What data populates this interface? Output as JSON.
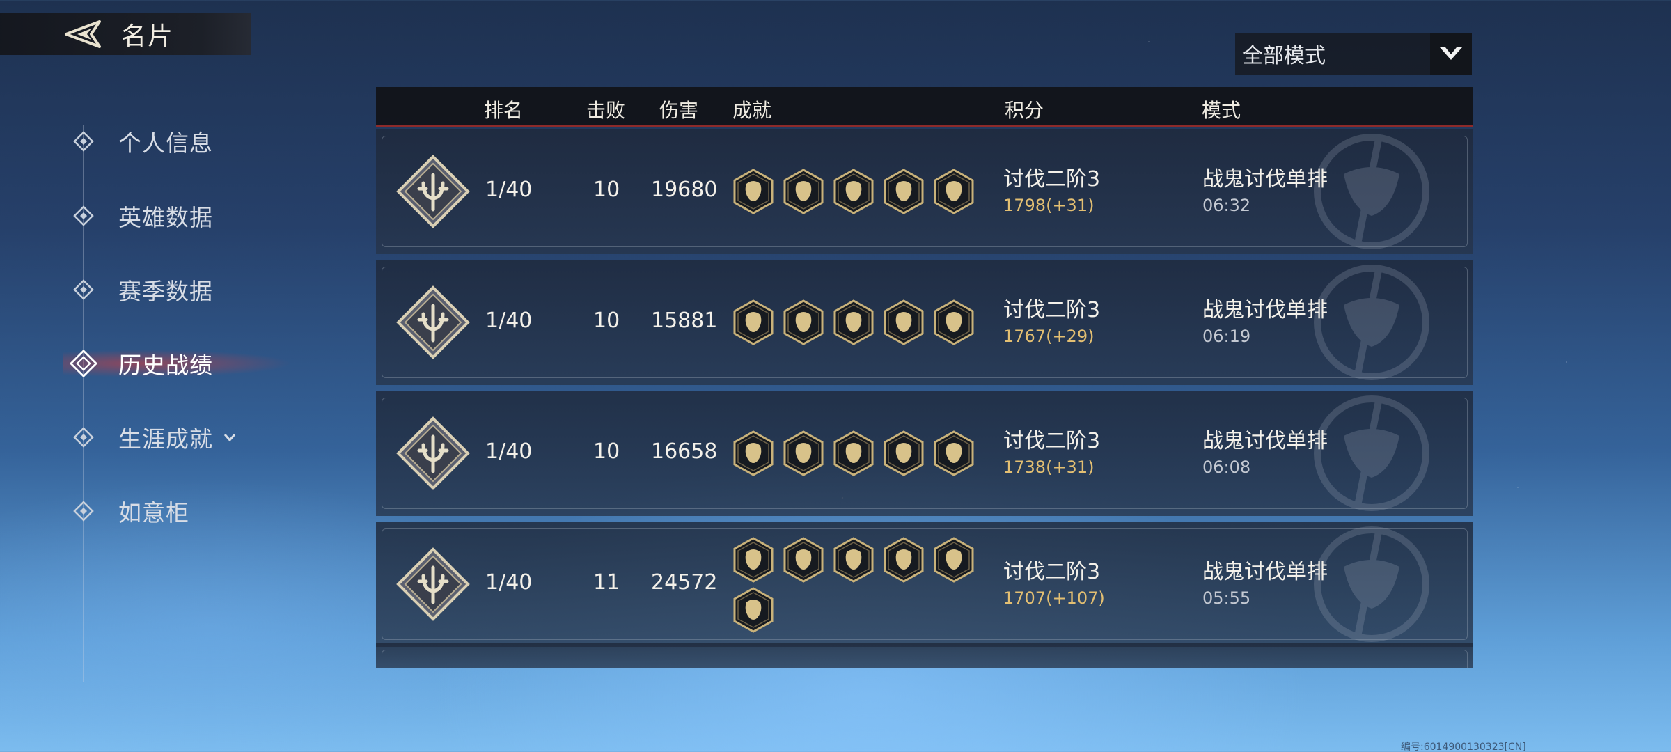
{
  "header": {
    "title": "名片"
  },
  "sidebar": {
    "items": [
      {
        "label": "个人信息"
      },
      {
        "label": "英雄数据"
      },
      {
        "label": "赛季数据"
      },
      {
        "label": "历史战绩",
        "active": true
      },
      {
        "label": "生涯成就",
        "has_chevron": true
      },
      {
        "label": "如意柜"
      }
    ]
  },
  "mode_filter": {
    "selected": "全部模式"
  },
  "table": {
    "columns": {
      "rank": "排名",
      "kills": "击败",
      "damage": "伤害",
      "achievements": "成就",
      "score": "积分",
      "mode": "模式"
    },
    "rows": [
      {
        "rank": "1/40",
        "kills": "10",
        "damage": "19680",
        "tier": "讨伐二阶3",
        "score": "1798(+31)",
        "mode": "战鬼讨伐单排",
        "time": "06:32",
        "achievements": [
          "lion-icon",
          "dragon-icon",
          "swirl-icon",
          "serpent-icon",
          "warrior-icon"
        ]
      },
      {
        "rank": "1/40",
        "kills": "10",
        "damage": "15881",
        "tier": "讨伐二阶3",
        "score": "1767(+29)",
        "mode": "战鬼讨伐单排",
        "time": "06:19",
        "achievements": [
          "lion-icon",
          "dragon-icon",
          "swirl-icon",
          "serpent-icon",
          "warrior-icon"
        ]
      },
      {
        "rank": "1/40",
        "kills": "10",
        "damage": "16658",
        "tier": "讨伐二阶3",
        "score": "1738(+31)",
        "mode": "战鬼讨伐单排",
        "time": "06:08",
        "achievements": [
          "lion-icon",
          "dragon-icon",
          "phoenix-icon",
          "serpent-icon",
          "pagoda-icon"
        ]
      },
      {
        "rank": "1/40",
        "kills": "11",
        "damage": "24572",
        "tier": "讨伐二阶3",
        "score": "1707(+107)",
        "mode": "战鬼讨伐单排",
        "time": "05:55",
        "achievements": [
          "lion-icon",
          "dragon-icon",
          "phoenix-icon",
          "serpent-icon",
          "monk-icon",
          "warrior-icon"
        ]
      }
    ]
  },
  "footer": {
    "id_text": "编号:6014900130323[CN]"
  },
  "colors": {
    "accent_red": "#8d2a2a",
    "score_gold": "#e3bf72",
    "icon_gold": "#d8c28a"
  }
}
